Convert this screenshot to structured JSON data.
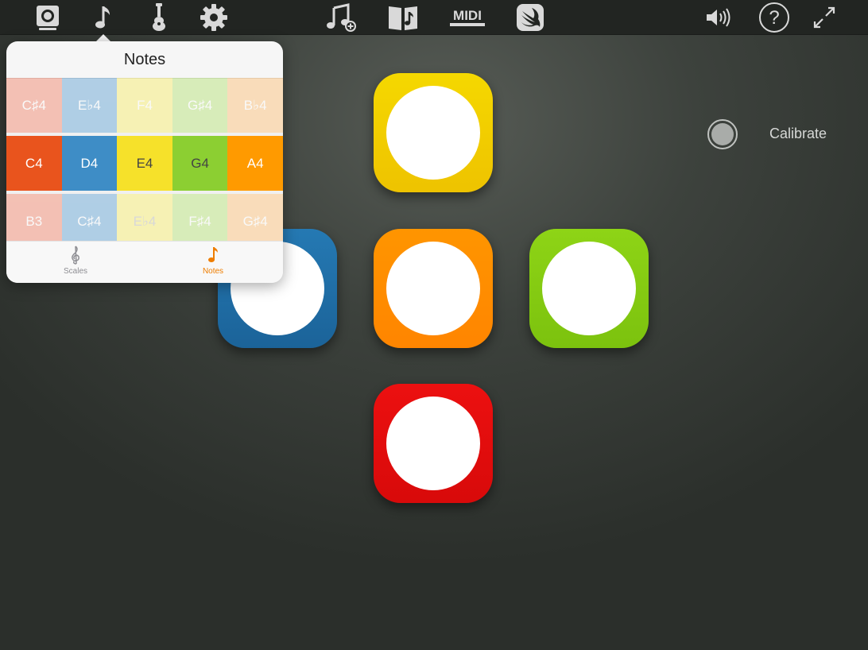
{
  "toolbar": {
    "midi_label": "MIDI",
    "help_label": "?",
    "active_tab": "notes"
  },
  "colors": {
    "blue": "#1f6fa8",
    "orange": "#ff8c00",
    "yellow": "#f2cf00",
    "green": "#86cc12",
    "red": "#e30d0d",
    "accent": "#ee7d00"
  },
  "pads": [
    {
      "name": "pad-top-yellow",
      "color": "#f2cf00"
    },
    {
      "name": "pad-left-blue",
      "color": "#1f6fa8"
    },
    {
      "name": "pad-center-orange",
      "color": "#ff8c00"
    },
    {
      "name": "pad-right-green",
      "color": "#86cc12"
    },
    {
      "name": "pad-bottom-red",
      "color": "#e30d0d"
    }
  ],
  "calibrate": {
    "label": "Calibrate"
  },
  "popover": {
    "title": "Notes",
    "rows": [
      {
        "faded": true,
        "cells": [
          {
            "note": "C♯4",
            "bg": "#f06b4a",
            "fg": "#ffffff"
          },
          {
            "note": "E♭4",
            "bg": "#3f8fcb",
            "fg": "#ffffff"
          },
          {
            "note": "F4",
            "bg": "#f6e94a",
            "fg": "#ffffff"
          },
          {
            "note": "G♯4",
            "bg": "#a6dc57",
            "fg": "#ffffff"
          },
          {
            "note": "B♭4",
            "bg": "#ffb45a",
            "fg": "#ffffff"
          }
        ]
      },
      {
        "faded": false,
        "cells": [
          {
            "note": "C4",
            "bg": "#e9541d",
            "fg": "#ffffff"
          },
          {
            "note": "D4",
            "bg": "#3e8dc6",
            "fg": "#ffffff"
          },
          {
            "note": "E4",
            "bg": "#f6e12a",
            "fg": "#444444"
          },
          {
            "note": "G4",
            "bg": "#8ccf32",
            "fg": "#444444"
          },
          {
            "note": "A4",
            "bg": "#ff9a00",
            "fg": "#ffffff"
          }
        ]
      },
      {
        "faded": true,
        "cells": [
          {
            "note": "B3",
            "bg": "#f06b4a",
            "fg": "#ffffff"
          },
          {
            "note": "C♯4",
            "bg": "#3f8fcb",
            "fg": "#ffffff"
          },
          {
            "note": "E♭4",
            "bg": "#f6e94a",
            "fg": "#aaaaaa"
          },
          {
            "note": "F♯4",
            "bg": "#a6dc57",
            "fg": "#ffffff"
          },
          {
            "note": "G♯4",
            "bg": "#ffb45a",
            "fg": "#ffffff"
          }
        ]
      }
    ],
    "tabs": [
      {
        "label": "Scales",
        "icon": "treble-clef-icon",
        "active": false
      },
      {
        "label": "Notes",
        "icon": "music-note-icon",
        "active": true
      }
    ]
  }
}
